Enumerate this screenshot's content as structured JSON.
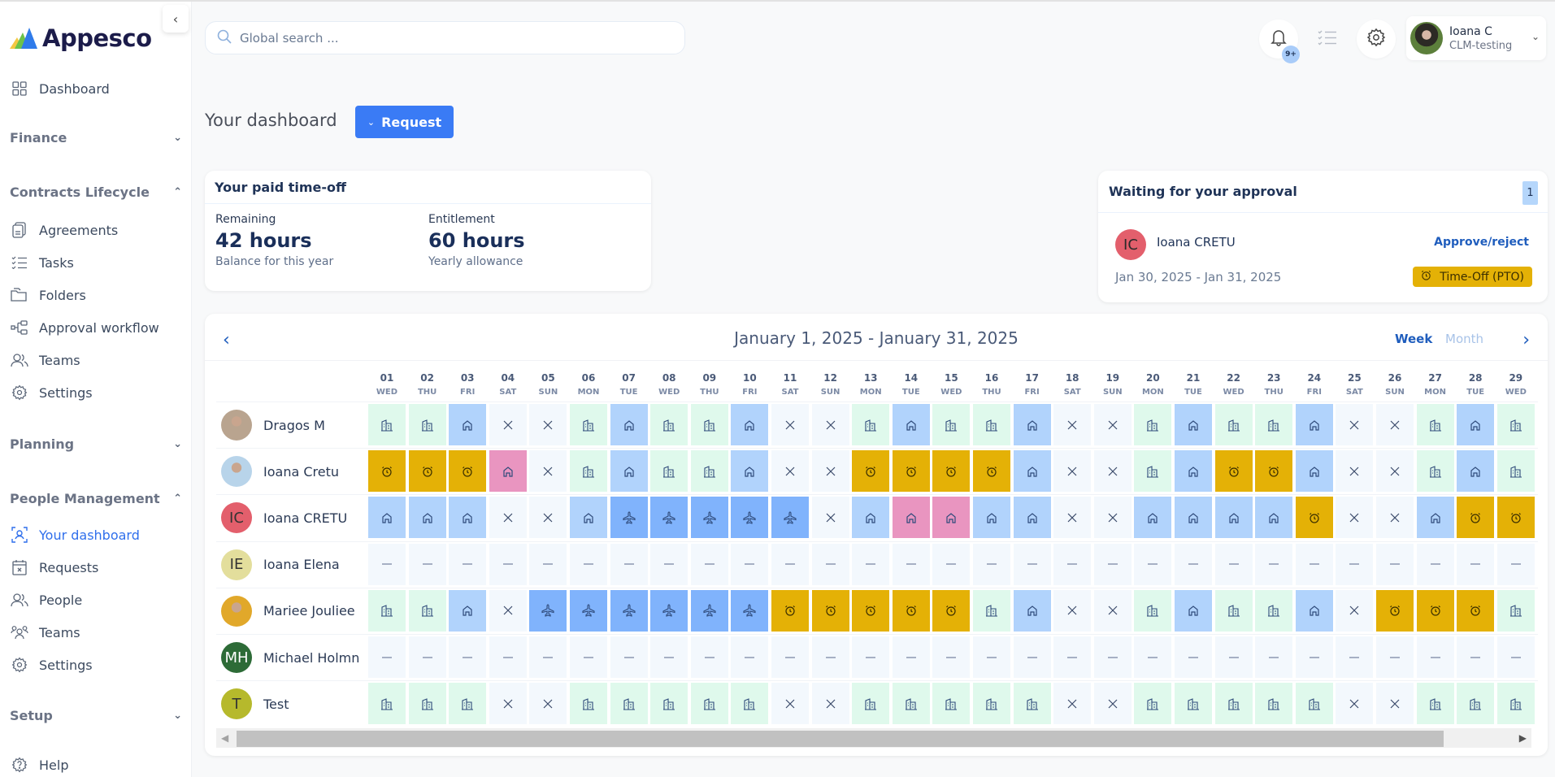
{
  "app": {
    "name": "Appesco"
  },
  "sidebar": {
    "top_item": {
      "label": "Dashboard",
      "icon": "grid-icon"
    },
    "sections": [
      {
        "label": "Finance",
        "expanded": false,
        "items": []
      },
      {
        "label": "Contracts Lifecycle",
        "expanded": true,
        "items": [
          {
            "label": "Agreements",
            "icon": "documents-icon"
          },
          {
            "label": "Tasks",
            "icon": "checklist-icon"
          },
          {
            "label": "Folders",
            "icon": "folders-icon"
          },
          {
            "label": "Approval workflow",
            "icon": "workflow-icon"
          },
          {
            "label": "Teams",
            "icon": "users-icon"
          },
          {
            "label": "Settings",
            "icon": "gear-icon"
          }
        ]
      },
      {
        "label": "Planning",
        "expanded": false,
        "items": []
      },
      {
        "label": "People Management",
        "expanded": true,
        "items": [
          {
            "label": "Your dashboard",
            "icon": "user-scan-icon",
            "active": true
          },
          {
            "label": "Requests",
            "icon": "calendar-x-icon"
          },
          {
            "label": "People",
            "icon": "users-icon"
          },
          {
            "label": "Teams",
            "icon": "team-icon"
          },
          {
            "label": "Settings",
            "icon": "gear-icon"
          }
        ]
      },
      {
        "label": "Setup",
        "expanded": false,
        "items": []
      }
    ],
    "help": {
      "label": "Help",
      "icon": "help-icon"
    }
  },
  "topbar": {
    "search_placeholder": "Global search ...",
    "notifications_badge": "9+",
    "user": {
      "name": "Ioana C",
      "org": "CLM-testing"
    }
  },
  "header": {
    "title": "Your dashboard",
    "request_label": "Request"
  },
  "pto": {
    "title": "Your paid time-off",
    "remaining": {
      "label": "Remaining",
      "value": "42 hours",
      "sub": "Balance for this year"
    },
    "entitlement": {
      "label": "Entitlement",
      "value": "60 hours",
      "sub": "Yearly allowance"
    }
  },
  "approval": {
    "title": "Waiting for your approval",
    "count": "1",
    "item": {
      "initials": "IC",
      "name": "Ioana CRETU",
      "action": "Approve/reject",
      "dates": "Jan 30, 2025 - Jan 31, 2025",
      "tag": "Time-Off (PTO)"
    }
  },
  "calendar": {
    "range": "January 1, 2025 - January 31, 2025",
    "view_week": "Week",
    "view_month": "Month",
    "days": [
      {
        "n": "01",
        "d": "WED"
      },
      {
        "n": "02",
        "d": "THU"
      },
      {
        "n": "03",
        "d": "FRI"
      },
      {
        "n": "04",
        "d": "SAT"
      },
      {
        "n": "05",
        "d": "SUN"
      },
      {
        "n": "06",
        "d": "MON"
      },
      {
        "n": "07",
        "d": "TUE"
      },
      {
        "n": "08",
        "d": "WED"
      },
      {
        "n": "09",
        "d": "THU"
      },
      {
        "n": "10",
        "d": "FRI"
      },
      {
        "n": "11",
        "d": "SAT"
      },
      {
        "n": "12",
        "d": "SUN"
      },
      {
        "n": "13",
        "d": "MON"
      },
      {
        "n": "14",
        "d": "TUE"
      },
      {
        "n": "15",
        "d": "WED"
      },
      {
        "n": "16",
        "d": "THU"
      },
      {
        "n": "17",
        "d": "FRI"
      },
      {
        "n": "18",
        "d": "SAT"
      },
      {
        "n": "19",
        "d": "SUN"
      },
      {
        "n": "20",
        "d": "MON"
      },
      {
        "n": "21",
        "d": "TUE"
      },
      {
        "n": "22",
        "d": "WED"
      },
      {
        "n": "23",
        "d": "THU"
      },
      {
        "n": "24",
        "d": "FRI"
      },
      {
        "n": "25",
        "d": "SAT"
      },
      {
        "n": "26",
        "d": "SUN"
      },
      {
        "n": "27",
        "d": "MON"
      },
      {
        "n": "28",
        "d": "TUE"
      },
      {
        "n": "29",
        "d": "WED"
      }
    ],
    "legend": {
      "O": {
        "type": "office",
        "icon": "building-icon"
      },
      "H": {
        "type": "home",
        "icon": "home-icon"
      },
      "W": {
        "type": "weekend",
        "icon": "x-icon"
      },
      "P": {
        "type": "pto",
        "icon": "alarm-clock-icon"
      },
      "T": {
        "type": "travel",
        "icon": "plane-icon"
      },
      "K": {
        "type": "pink",
        "icon": "home-icon"
      },
      "N": {
        "type": "none",
        "icon": "dash-icon"
      }
    },
    "people": [
      {
        "name": "Dragos M",
        "initials": "",
        "avatar_color": "#b9a48f",
        "photo": true,
        "cells": "OOHWWOHOOHWWOHOOHWWOHOOHWWOHO"
      },
      {
        "name": "Ioana Cretu",
        "initials": "",
        "avatar_color": "#b8d4ea",
        "photo": true,
        "cells": "PPPKWOHOOHWWPPPPHWWOHPPHWWOHO"
      },
      {
        "name": "Ioana CRETU",
        "initials": "IC",
        "avatar_color": "#e35f6c",
        "photo": false,
        "cells": "HHHWWHTTTTTWHKKHHWWHHHHPWWHPP"
      },
      {
        "name": "Ioana Elena",
        "initials": "IE",
        "avatar_color": "#e3de9c",
        "photo": false,
        "cells": "NNNNNNNNNNNNNNNNNNNNNNNNNNNNN"
      },
      {
        "name": "Mariee Jouliee",
        "initials": "",
        "avatar_color": "#e1a82a",
        "photo": true,
        "cells": "OOHWTTTTTTPPPPPOHWWOHOOHWPPPO"
      },
      {
        "name": "Michael Holmn",
        "initials": "MH",
        "avatar_color": "#2d6b37",
        "photo": false,
        "cells": "NNNNNNNNNNNNNNNNNNNNNNNNNNNNN"
      },
      {
        "name": "Test",
        "initials": "T",
        "avatar_color": "#b6b92c",
        "photo": false,
        "cells": "OOOWWOOOOOWWOOOOOWWOOOOOWWOOO"
      }
    ]
  }
}
